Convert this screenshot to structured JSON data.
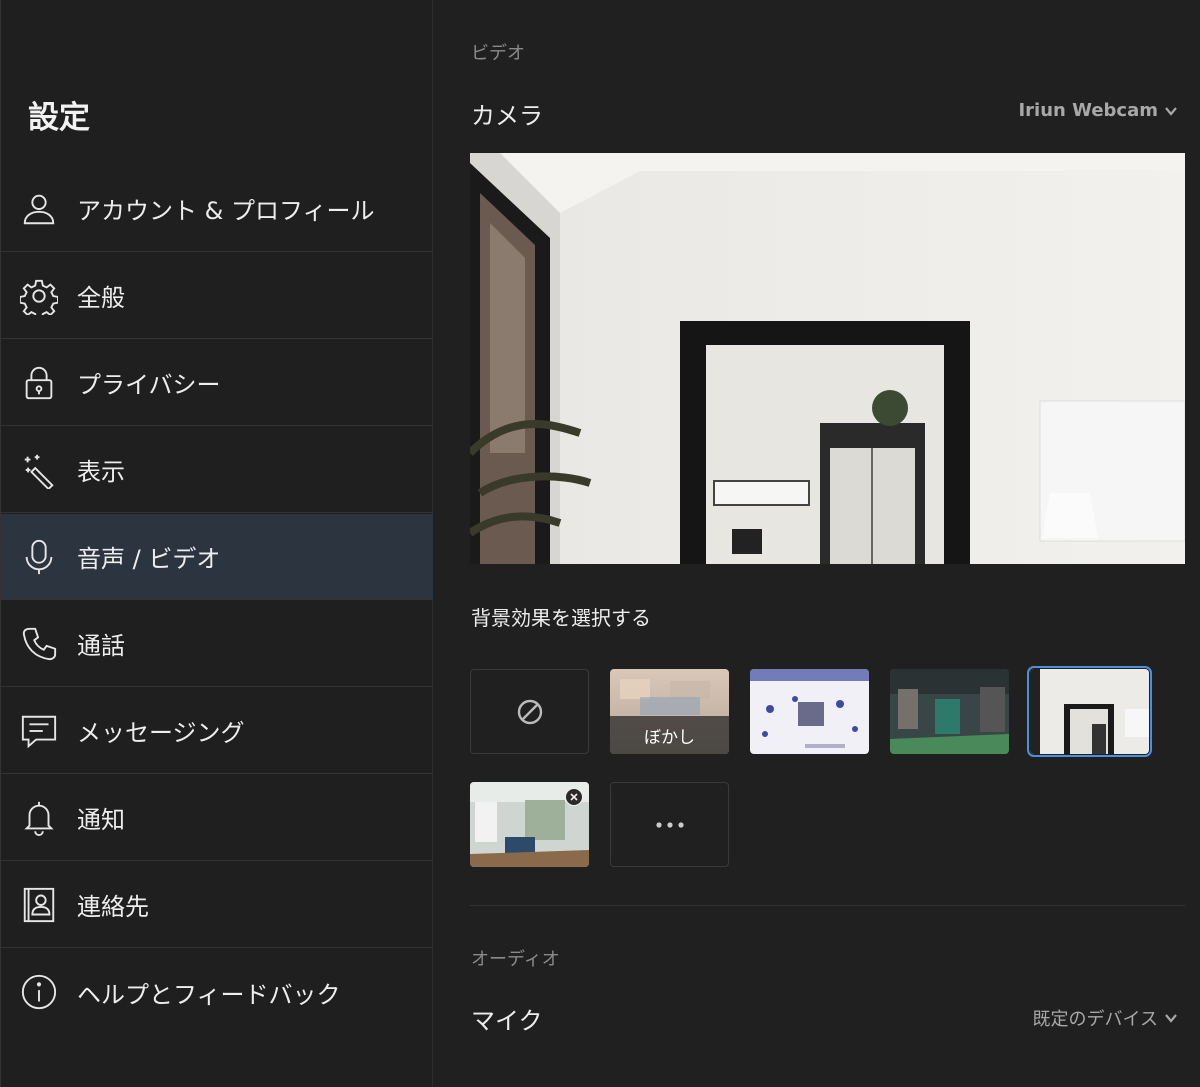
{
  "sidebar": {
    "title": "設定",
    "items": [
      {
        "label": "アカウント & プロフィール",
        "icon": "person-icon"
      },
      {
        "label": "全般",
        "icon": "gear-icon"
      },
      {
        "label": "プライバシー",
        "icon": "lock-icon"
      },
      {
        "label": "表示",
        "icon": "magic-wand-icon"
      },
      {
        "label": "音声 / ビデオ",
        "icon": "microphone-icon",
        "active": true
      },
      {
        "label": "通話",
        "icon": "phone-icon"
      },
      {
        "label": "メッセージング",
        "icon": "message-icon"
      },
      {
        "label": "通知",
        "icon": "bell-icon"
      },
      {
        "label": "連絡先",
        "icon": "contact-book-icon"
      },
      {
        "label": "ヘルプとフィードバック",
        "icon": "info-icon"
      }
    ]
  },
  "video": {
    "section_label": "ビデオ",
    "camera_label": "カメラ",
    "camera_device": "Iriun Webcam",
    "background_label": "背景効果を選択する",
    "backgrounds": [
      {
        "type": "none",
        "icon": "no-symbol-icon"
      },
      {
        "type": "blur",
        "label": "ぼかし"
      },
      {
        "type": "image",
        "name": "pattern"
      },
      {
        "type": "image",
        "name": "office"
      },
      {
        "type": "image",
        "name": "room",
        "selected": true
      },
      {
        "type": "image",
        "name": "custom-room",
        "removable": true
      },
      {
        "type": "more",
        "icon": "more-icon"
      }
    ]
  },
  "audio": {
    "section_label": "オーディオ",
    "mic_label": "マイク",
    "mic_device": "既定のデバイス"
  },
  "colors": {
    "active_item": "#2c3440",
    "selected_outline": "#4d8fdd"
  }
}
